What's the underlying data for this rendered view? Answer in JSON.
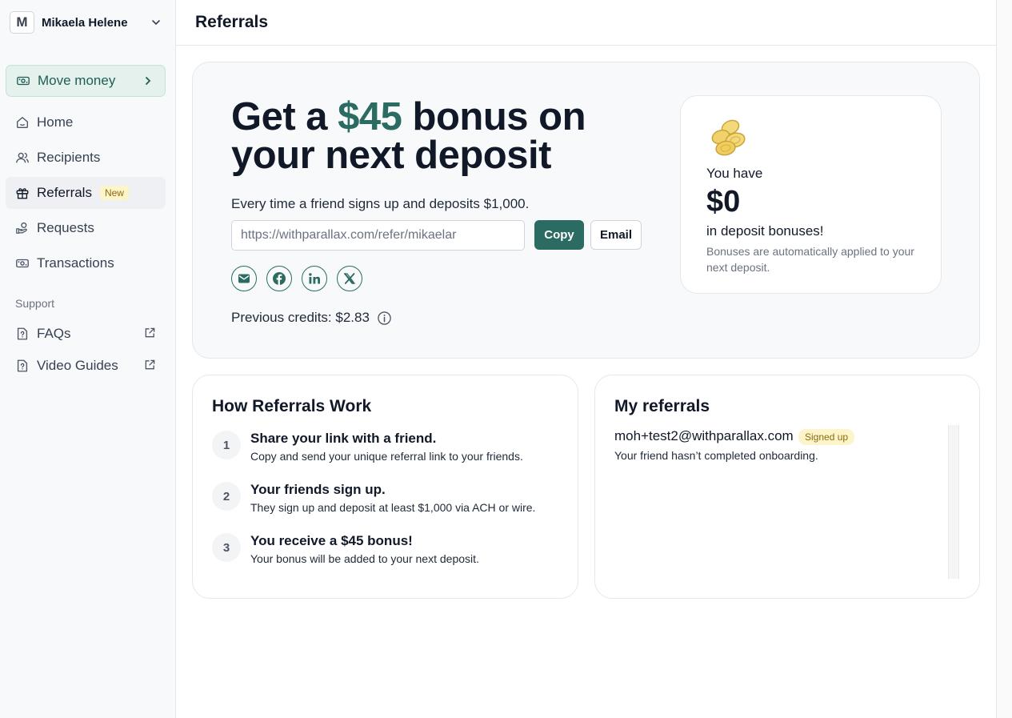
{
  "account": {
    "initial": "M",
    "name": "Mikaela Helene"
  },
  "sidebar": {
    "move_money": "Move money",
    "items": [
      {
        "label": "Home"
      },
      {
        "label": "Recipients"
      },
      {
        "label": "Referrals",
        "badge": "New"
      },
      {
        "label": "Requests"
      },
      {
        "label": "Transactions"
      }
    ],
    "support_header": "Support",
    "support_items": [
      {
        "label": "FAQs"
      },
      {
        "label": "Video Guides"
      }
    ]
  },
  "header": {
    "title": "Referrals"
  },
  "hero": {
    "headline_pre": "Get a ",
    "headline_amount": "$45",
    "headline_post": " bonus on your next deposit",
    "subtitle": "Every time a friend signs up and deposits $1,000.",
    "referral_link": "https://withparallax.com/refer/mikaelar",
    "copy_label": "Copy",
    "email_label": "Email",
    "previous_credits": "Previous credits: $2.83"
  },
  "bonus": {
    "you_have": "You have",
    "amount": "$0",
    "in_deposit": "in deposit bonuses!",
    "note": "Bonuses are automatically applied to your next deposit."
  },
  "how": {
    "title": "How Referrals Work",
    "steps": [
      {
        "num": "1",
        "title": "Share your link with a friend.",
        "desc": "Copy and send your unique referral link to your friends."
      },
      {
        "num": "2",
        "title": "Your friends sign up.",
        "desc": "They sign up and deposit at least $1,000 via ACH or wire."
      },
      {
        "num": "3",
        "title": "You receive a $45 bonus!",
        "desc": "Your bonus will be added to your next deposit."
      }
    ]
  },
  "my_referrals": {
    "title": "My referrals",
    "items": [
      {
        "email": "moh+test2@withparallax.com",
        "badge": "Signed up",
        "status": "Your friend hasn’t completed onboarding."
      }
    ]
  },
  "colors": {
    "accent": "#2b6b62",
    "badge_bg": "#fdf4c9",
    "badge_text": "#8a6d10"
  }
}
